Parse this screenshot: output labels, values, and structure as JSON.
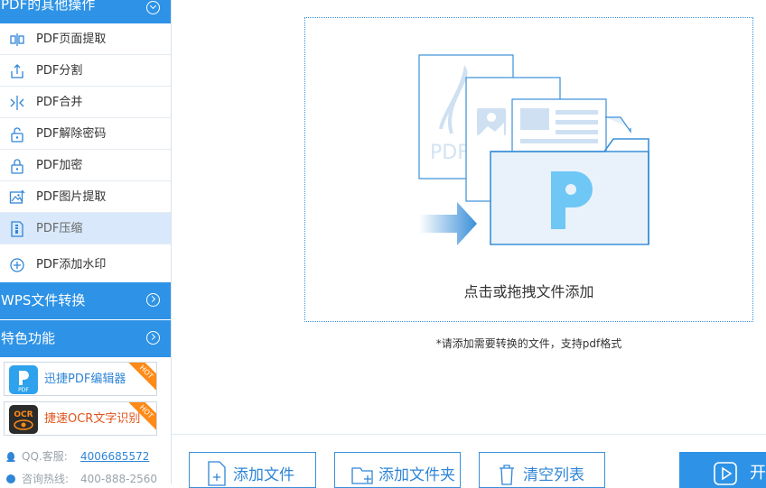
{
  "sidebar": {
    "pdf_other": {
      "title": "PDF的其他操作"
    },
    "items": [
      {
        "label": "PDF页面提取"
      },
      {
        "label": "PDF分割"
      },
      {
        "label": "PDF合并"
      },
      {
        "label": "PDF解除密码"
      },
      {
        "label": "PDF加密"
      },
      {
        "label": "PDF图片提取"
      },
      {
        "label": "PDF压缩"
      },
      {
        "label": "PDF添加水印"
      }
    ],
    "wps": {
      "title": "WPS文件转换"
    },
    "special": {
      "title": "特色功能"
    },
    "promos": [
      {
        "label": "迅捷PDF编辑器",
        "badge": "HOT",
        "logo_text": "PDF",
        "color": "#2f85d6"
      },
      {
        "label": "捷速OCR文字识别",
        "badge": "HOT",
        "logo_text": "OCR",
        "color": "#e0541b"
      }
    ],
    "contacts": [
      {
        "label": "QQ.客服:",
        "value": "4006685572"
      },
      {
        "label": "咨询热线:",
        "value": "400-888-2560"
      }
    ]
  },
  "main": {
    "drop_text": "点击或拖拽文件添加",
    "hint": "*请添加需要转换的文件，支持pdf格式",
    "illustration_text": "PDF",
    "buttons": [
      {
        "label": "添加文件"
      },
      {
        "label": "添加文件夹"
      },
      {
        "label": "清空列表"
      }
    ],
    "start_label": "开"
  },
  "colors": {
    "accent": "#2e93e6",
    "active_bg": "#d9e9fb"
  }
}
